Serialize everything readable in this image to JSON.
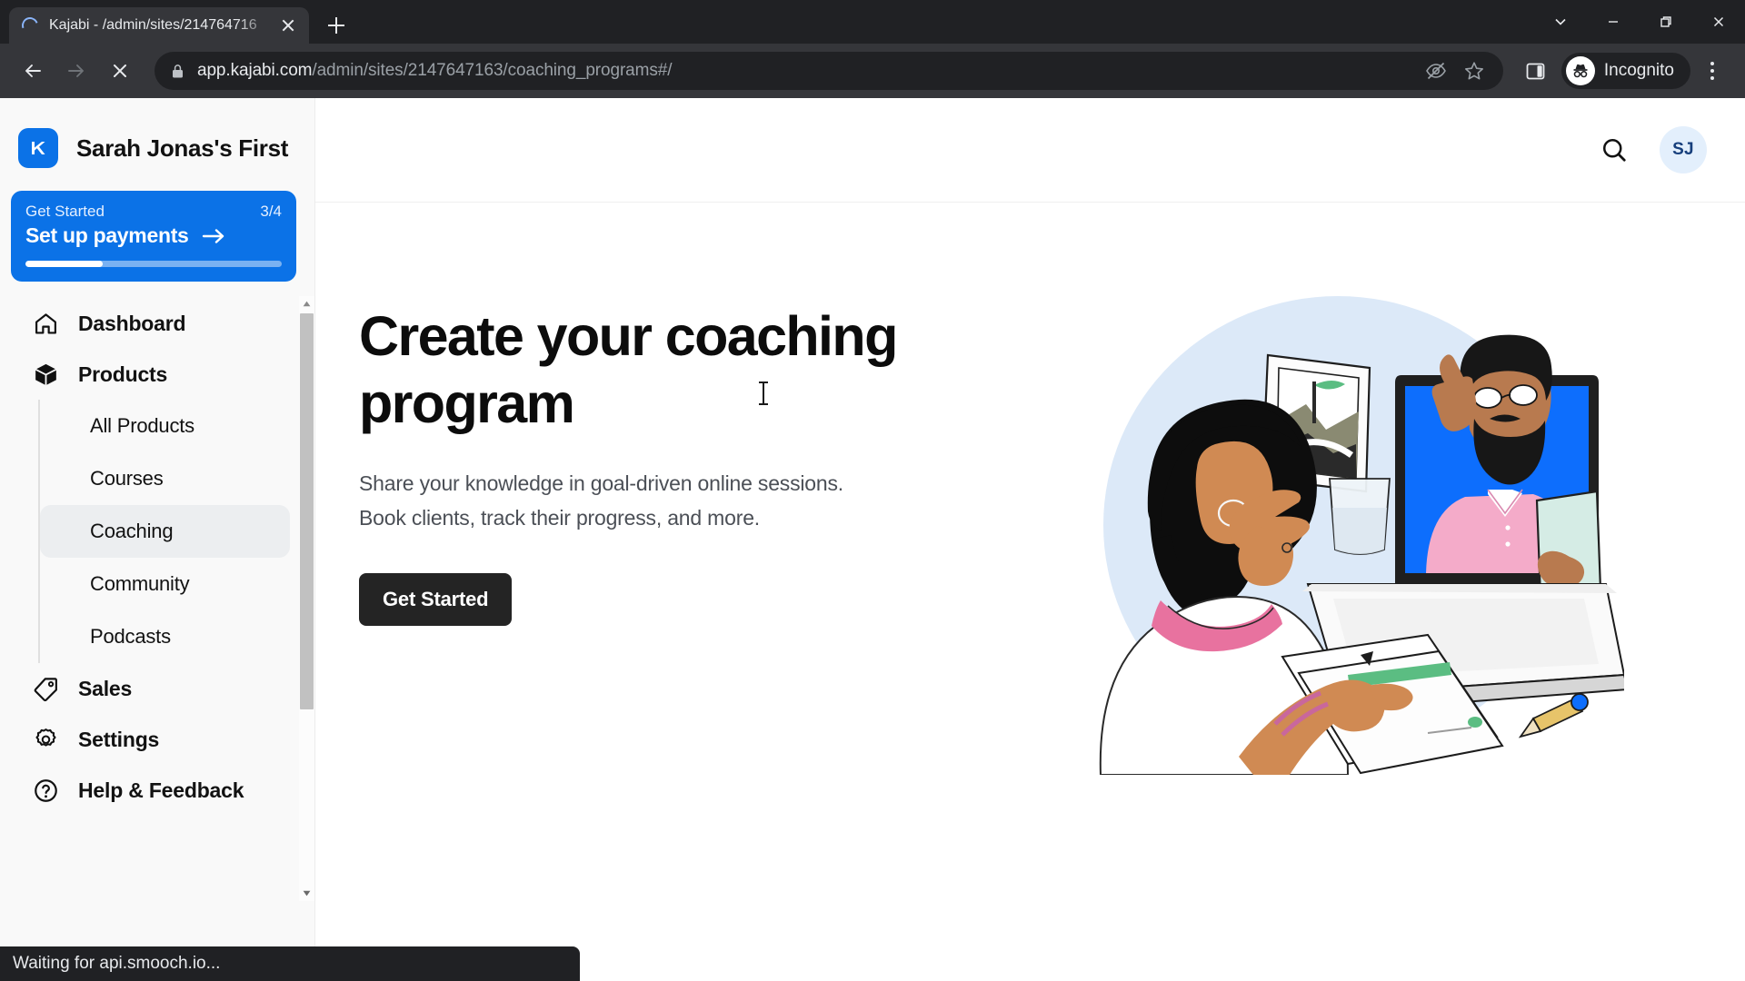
{
  "browser": {
    "tab": {
      "title": "Kajabi - /admin/sites/214764716",
      "spinner_icon": "loading-spinner-icon",
      "close_icon": "close-icon"
    },
    "new_tab_icon": "plus-icon",
    "window_controls": [
      {
        "name": "tab-search-button",
        "icon": "chevron-down-icon"
      },
      {
        "name": "minimize-button",
        "icon": "minimize-icon"
      },
      {
        "name": "maximize-button",
        "icon": "maximize-icon"
      },
      {
        "name": "close-window-button",
        "icon": "close-icon"
      }
    ],
    "nav": {
      "back_icon": "arrow-left-icon",
      "forward_icon": "arrow-right-icon",
      "stop_icon": "stop-loading-icon"
    },
    "omnibox": {
      "lock_icon": "lock-icon",
      "url_domain": "app.kajabi.com",
      "url_path": "/admin/sites/2147647163/coaching_programs#/",
      "third_party_cookie_icon": "eye-slash-icon",
      "bookmark_icon": "star-icon"
    },
    "toolbar": {
      "side_panel_icon": "side-panel-icon",
      "incognito_label": "Incognito",
      "incognito_icon": "incognito-hat-icon",
      "menu_icon": "kebab-menu-icon"
    },
    "status_text": "Waiting for api.smooch.io..."
  },
  "sidebar": {
    "brand": {
      "name": "Sarah Jonas's First",
      "logo_icon": "kajabi-logo-icon",
      "logo_color": "#0b72e7"
    },
    "get_started": {
      "label": "Get Started",
      "count": "3/4",
      "title": "Set up payments",
      "arrow_icon": "arrow-right-icon",
      "progress_percent": 30,
      "bg_color": "#0b72e7"
    },
    "nav": [
      {
        "label": "Dashboard",
        "icon": "home-icon",
        "active": false
      },
      {
        "label": "Products",
        "icon": "box-icon",
        "active": false
      }
    ],
    "subnav": [
      {
        "label": "All Products",
        "active": false
      },
      {
        "label": "Courses",
        "active": false
      },
      {
        "label": "Coaching",
        "active": true
      },
      {
        "label": "Community",
        "active": false
      },
      {
        "label": "Podcasts",
        "active": false
      }
    ],
    "nav_bottom": [
      {
        "label": "Sales",
        "icon": "tag-icon",
        "active": false
      },
      {
        "label": "Settings",
        "icon": "gear-icon",
        "active": false
      },
      {
        "label": "Help & Feedback",
        "icon": "question-circle-icon",
        "active": false
      }
    ],
    "scrollbar": {
      "up_icon": "scroll-up-arrow-icon",
      "down_icon": "scroll-down-arrow-icon"
    }
  },
  "header": {
    "search_icon": "search-icon",
    "avatar_initials": "SJ",
    "avatar_bg": "#e3effc",
    "avatar_fg": "#173f7c"
  },
  "main": {
    "title": "Create your coaching program",
    "subtitle_line1": "Share your knowledge in goal-driven online sessions.",
    "subtitle_line2": "Book clients, track their progress, and more.",
    "cta_label": "Get Started",
    "cta_bg": "#242424",
    "illustration": {
      "name": "coaching-session-illustration",
      "bg_color": "#dce9f8",
      "accent_pink": "#f6b2cc",
      "accent_blue": "#0d6efd",
      "accent_green": "#5bbd82"
    }
  }
}
